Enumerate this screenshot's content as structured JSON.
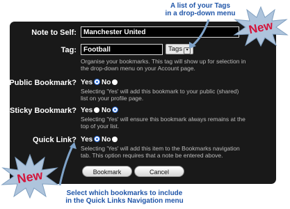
{
  "annotations": {
    "top_note": [
      "A list of your Tags",
      "in a drop-down menu"
    ],
    "bottom_note": [
      "Select which bookmarks to include",
      "in the  Quick Links Navigation menu"
    ],
    "new_badge_top": "New",
    "new_badge_bottom": "New"
  },
  "form": {
    "note_label": "Note to Self:",
    "note_value": "Manchester United",
    "tag_label": "Tag:",
    "tag_value": "Football",
    "tags_dropdown_label": "Tags",
    "tag_help": "Organise your bookmarks. This tag will show up for selection in the drop-down menu on your Account page.",
    "public_label": "Public Bookmark?",
    "public_help": "Selecting 'Yes' will add this bookmark to your public (shared) list on your profile page.",
    "sticky_label": "Sticky Bookmark?",
    "sticky_help": "Selecting 'Yes' will ensure this bookmark always remains at the top of your list.",
    "quick_label": "Quick Link?",
    "quick_help": "Selecting 'Yes' will add this item to the Bookmarks navigation tab. This option requires that a note be entered above.",
    "yes": "Yes",
    "no": "No",
    "bookmark_button": "Bookmark",
    "cancel_button": "Cancel"
  },
  "selections": {
    "public": "Yes",
    "sticky": "No",
    "quick_link": "Yes"
  },
  "colors": {
    "panel": "#191919",
    "annotation_text": "#1f55a8",
    "badge_fill": "#aec4dc",
    "badge_text": "#d4143a"
  }
}
